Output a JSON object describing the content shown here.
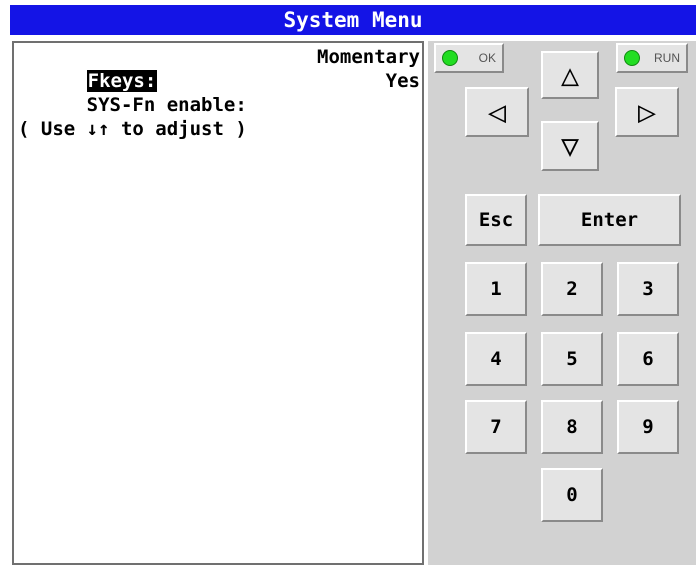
{
  "title": "System Menu",
  "screen": {
    "fkeys_label": "Fkeys:",
    "fkeys_value": "Momentary",
    "sysfn_label": "SYS-Fn enable:",
    "sysfn_value": "Yes",
    "hint": "( Use ↓↑ to adjust )"
  },
  "indicators": {
    "ok_label": "OK",
    "run_label": "RUN",
    "led_color": "#22dd22"
  },
  "keys": {
    "up": "△",
    "down": "▽",
    "left": "◁",
    "right": "▷",
    "esc": "Esc",
    "enter": "Enter",
    "d1": "1",
    "d2": "2",
    "d3": "3",
    "d4": "4",
    "d5": "5",
    "d6": "6",
    "d7": "7",
    "d8": "8",
    "d9": "9",
    "d0": "0"
  },
  "colors": {
    "title_bg": "#1414e6",
    "panel_bg": "#d2d2d2",
    "button_bg": "#e4e4e4"
  }
}
